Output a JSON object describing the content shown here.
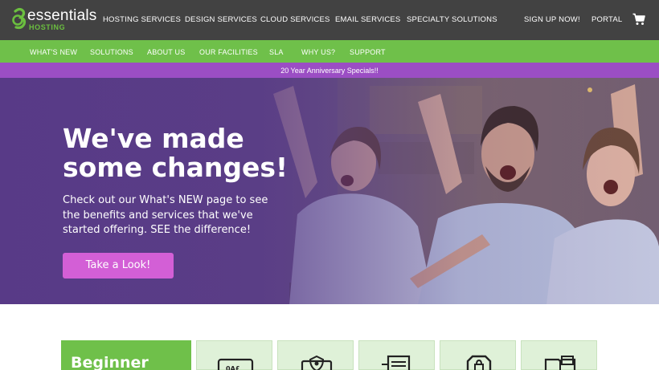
{
  "brand": {
    "logo_word": "essentials",
    "logo_sub": "HOSTING"
  },
  "topnav": {
    "items": [
      "HOSTING SERVICES",
      "DESIGN SERVICES",
      "CLOUD SERVICES",
      "EMAIL SERVICES",
      "SPECIALTY SOLUTIONS"
    ],
    "signup": "SIGN UP NOW!",
    "portal": "PORTAL",
    "cart_icon": "shopping-cart-icon"
  },
  "subnav": {
    "items": [
      "WHAT'S NEW",
      "SOLUTIONS",
      "ABOUT US",
      "OUR FACILITIES",
      "SLA",
      "WHY US?",
      "SUPPORT"
    ]
  },
  "promo": {
    "text": "20 Year Anniversary Specials!!"
  },
  "hero": {
    "title_line1": "We've made",
    "title_line2": "some changes!",
    "body": "Check out our What's NEW page to see the benefits and services that we've started offering. SEE the difference!",
    "button": "Take a Look!"
  },
  "plans": {
    "first_label": "Beginner",
    "card_icons": [
      "html-window-icon",
      "security-shield-icon",
      "server-document-icon",
      "lock-badge-icon",
      "book-icon"
    ]
  },
  "colors": {
    "topbar": "#424242",
    "green": "#6fc04a",
    "purple": "#9b4ec4",
    "button": "#d35fd6",
    "card_bg": "#dff1d8"
  }
}
